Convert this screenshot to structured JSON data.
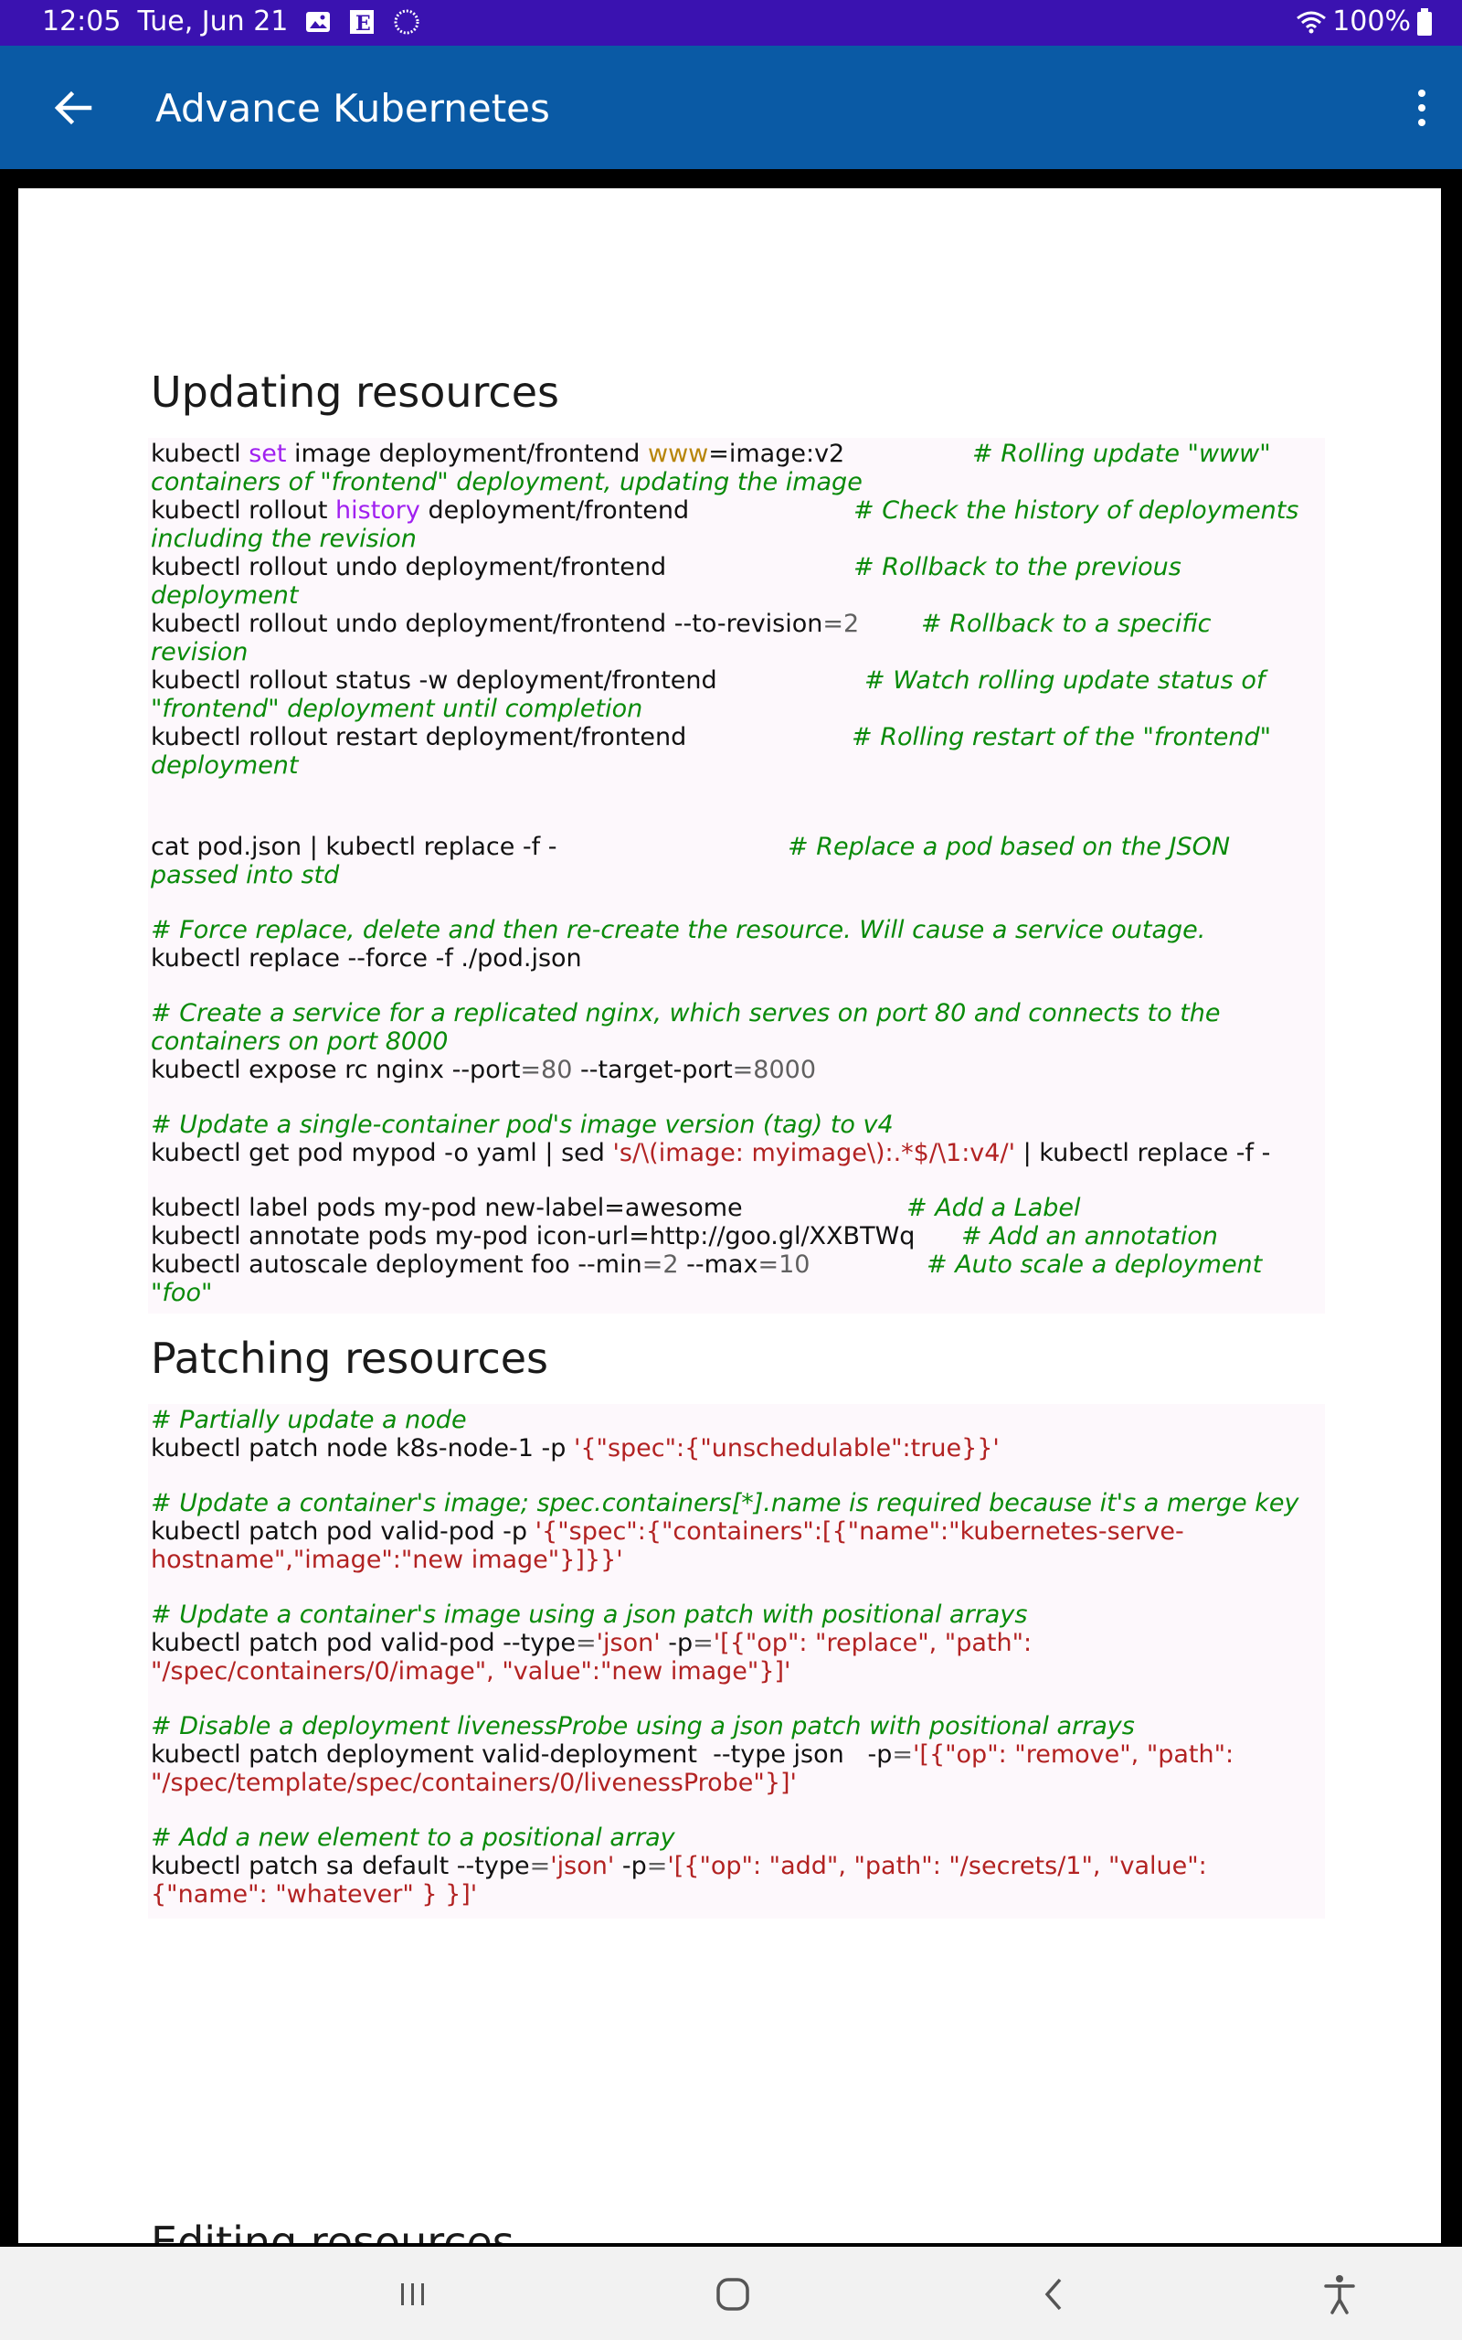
{
  "status": {
    "time": "12:05",
    "date": "Tue, Jun 21",
    "battery": "100%"
  },
  "appbar": {
    "title": "Advance Kubernetes"
  },
  "sections": {
    "updating_title": "Updating resources",
    "patching_title": "Patching resources",
    "editing_title": "Editing resources"
  },
  "updating": {
    "l1a": "kubectl ",
    "l1kw": "set",
    "l1b": " image deployment/frontend ",
    "l1var": "www",
    "l1c": "=image:v2",
    "l1cm": "# Rolling update \"www\"",
    "l2cm": "containers of \"frontend\" deployment, updating the image",
    "l3a": "kubectl rollout ",
    "l3kw": "history",
    "l3b": " deployment/frontend",
    "l3cm": "# Check the history of deployments",
    "l4cm": "including the revision",
    "l5a": "kubectl rollout undo deployment/frontend",
    "l5cm": "# Rollback to the previous",
    "l6cm": "deployment",
    "l7a": "kubectl rollout undo deployment/frontend --to-revision",
    "l7b": "=",
    "l7n": "2",
    "l7cm": "# Rollback to a specific",
    "l8cm": "revision",
    "l9a": "kubectl rollout status -w deployment/frontend",
    "l9cm": "# Watch rolling update status of",
    "l10cm": "\"frontend\" deployment until completion",
    "l11a": "kubectl rollout restart deployment/frontend",
    "l11cm": "# Rolling restart of the \"frontend\"",
    "l12cm": "deployment",
    "l13a": "cat pod.json | kubectl replace -f -",
    "l13cm": "# Replace a pod based on the JSON",
    "l14cm": "passed into std",
    "l15cm": "# Force replace, delete and then re-create the resource. Will cause a service outage.",
    "l16a": "kubectl replace --force -f ./pod.json",
    "l17cm": "# Create a service for a replicated nginx, which serves on port 80 and connects to the",
    "l18cm": "containers on port 8000",
    "l19a": "kubectl expose rc nginx --port",
    "l19b": "=",
    "l19n1": "80",
    "l19c": " --target-port",
    "l19d": "=",
    "l19n2": "8000",
    "l20cm": "# Update a single-container pod's image version (tag) to v4",
    "l21a": "kubectl get pod mypod -o yaml | sed ",
    "l21st": "'s/\\(image: myimage\\):.*$/\\1:v4/'",
    "l21b": " | kubectl replace -f -",
    "l22a": "kubectl label pods my-pod new-label",
    "l22b": "=awesome",
    "l22cm": "# Add a Label",
    "l23a": "kubectl annotate pods my-pod icon-url",
    "l23b": "=http://goo.gl/XXBTWq",
    "l23cm": "# Add an annotation",
    "l24a": "kubectl autoscale deployment foo --min",
    "l24b": "=",
    "l24n1": "2",
    "l24c": " --max",
    "l24d": "=",
    "l24n2": "10",
    "l24cm": "# Auto scale a deployment",
    "l25cm": "\"foo\""
  },
  "patching": {
    "p1cm": "# Partially update a node",
    "p2a": "kubectl patch node k8s-node-1 -p ",
    "p2st": "'{\"spec\":{\"unschedulable\":true}}'",
    "p3cm": "# Update a container's image; spec.containers[*].name is required because it's a merge key",
    "p4a": "kubectl patch pod valid-pod -p ",
    "p4st": "'{\"spec\":{\"containers\":[{\"name\":\"kubernetes-serve-",
    "p5st": "hostname\",\"image\":\"new image\"}]}}'",
    "p6cm": "# Update a container's image using a json patch with positional arrays",
    "p7a": "kubectl patch pod valid-pod --type",
    "p7b": "=",
    "p7st1": "'json'",
    "p7c": " -p",
    "p7d": "=",
    "p7st2": "'[{\"op\": \"replace\", \"path\":",
    "p8st": "\"/spec/containers/0/image\", \"value\":\"new image\"}]'",
    "p9cm": "# Disable a deployment livenessProbe using a json patch with positional arrays",
    "p10a": "kubectl patch deployment valid-deployment  --type json   -p",
    "p10b": "=",
    "p10st": "'[{\"op\": \"remove\", \"path\":",
    "p11st": "\"/spec/template/spec/containers/0/livenessProbe\"}]'",
    "p12cm": "# Add a new element to a positional array",
    "p13a": "kubectl patch sa default --type",
    "p13b": "=",
    "p13st1": "'json'",
    "p13c": " -p",
    "p13d": "=",
    "p13st2": "'[{\"op\": \"add\", \"path\": \"/secrets/1\", \"value\":",
    "p14st": "{\"name\": \"whatever\" } }]'"
  }
}
